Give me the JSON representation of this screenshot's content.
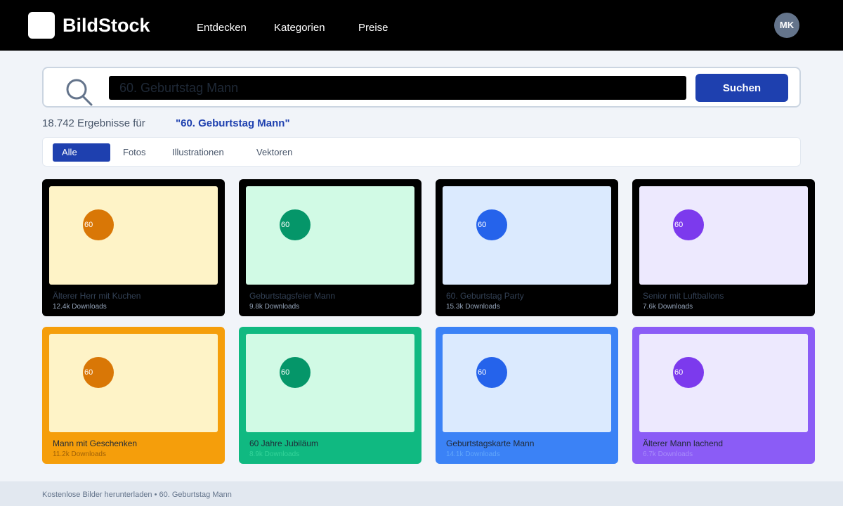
{
  "header": {
    "brand": "BildStock",
    "nav": [
      "Entdecken",
      "Kategorien",
      "Preise"
    ],
    "avatar_initials": "MK"
  },
  "search": {
    "value": "",
    "placeholder": "60. Geburtstag Mann",
    "button_label": "Suchen",
    "icon": "search-icon"
  },
  "results": {
    "count_text": "18.742 Ergebnisse für",
    "query_text": "\"60. Geburtstag Mann\""
  },
  "filters": {
    "tabs": [
      "Alle",
      "Fotos",
      "Illustrationen",
      "Vektoren"
    ],
    "active": "Alle"
  },
  "cards": [
    {
      "title": "Älterer Herr mit Kuchen",
      "downloads": "12.4k Downloads",
      "badge": "60"
    },
    {
      "title": "Geburtstagsfeier Mann",
      "downloads": "9.8k Downloads",
      "badge": "60"
    },
    {
      "title": "60. Geburtstag Party",
      "downloads": "15.3k Downloads",
      "badge": "60"
    },
    {
      "title": "Senior mit Luftballons",
      "downloads": "7.6k Downloads",
      "badge": "60"
    },
    {
      "title": "Mann mit Geschenken",
      "downloads": "11.2k Downloads",
      "badge": "60"
    },
    {
      "title": "60 Jahre Jubiläum",
      "downloads": "8.9k Downloads",
      "badge": "60"
    },
    {
      "title": "Geburtstagskarte Mann",
      "downloads": "14.1k Downloads",
      "badge": "60"
    },
    {
      "title": "Älterer Mann lachend",
      "downloads": "6.7k Downloads",
      "badge": "60"
    }
  ],
  "footer": {
    "text": "Kostenlose Bilder herunterladen • 60. Geburtstag Mann"
  },
  "colors": {
    "accent": "#1e40af",
    "header_bg": "#000000",
    "page_bg": "#f1f4f9",
    "amber": "#f59e0b",
    "amber_thumb": "#fef3c7",
    "amber_badge": "#d97706",
    "green": "#10b981",
    "green_thumb": "#d1fae5",
    "green_badge": "#059669",
    "blue": "#3b82f6",
    "blue_thumb": "#dbeafe",
    "blue_badge": "#2563eb",
    "purple": "#8b5cf6",
    "purple_thumb": "#ede9fe",
    "purple_badge": "#7c3aed"
  }
}
